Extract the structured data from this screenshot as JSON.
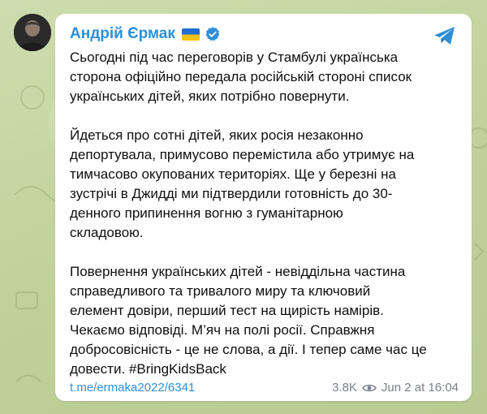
{
  "post": {
    "author": "Андрій Єрмак",
    "text": "Сьогодні під час переговорів у Стамбулі українська\nсторона офіційно передала російській стороні список\nукраїнських дітей, яких потрібно повернути.\n\nЙдеться про сотні дітей, яких росія незаконно\nдепортувала, примусово перемістила або утримує на\nтимчасово окупованих територіях. Ще у березні на\nзустрічі в Джидді ми підтвердили готовність до 30-\nденного припинення вогню з гуманітарною\nскладовою.\n\nПовернення українських дітей - невіддільна частина\nсправедливого та тривалого миру та ключовий\nелемент довіри, перший тест на щирість намірів.\nЧекаємо відповіді. М’яч на полі росії. Справжня\nдобросовісність - це не слова, а дії. І тепер саме час це\nдовести. #BringKidsBack",
    "link": "t.me/ermaka2022/6341",
    "views": "3.8K",
    "date": "Jun 2 at 16:04"
  },
  "icons": {
    "flag": "ukraine-flag-icon",
    "verified": "verified-badge-icon",
    "share": "telegram-share-icon",
    "views": "eye-icon"
  },
  "colors": {
    "accent": "#2f8fd6",
    "text": "#0f0f0f",
    "meta": "#7a8089",
    "background": "#c6d6a3",
    "card": "#ffffff"
  }
}
